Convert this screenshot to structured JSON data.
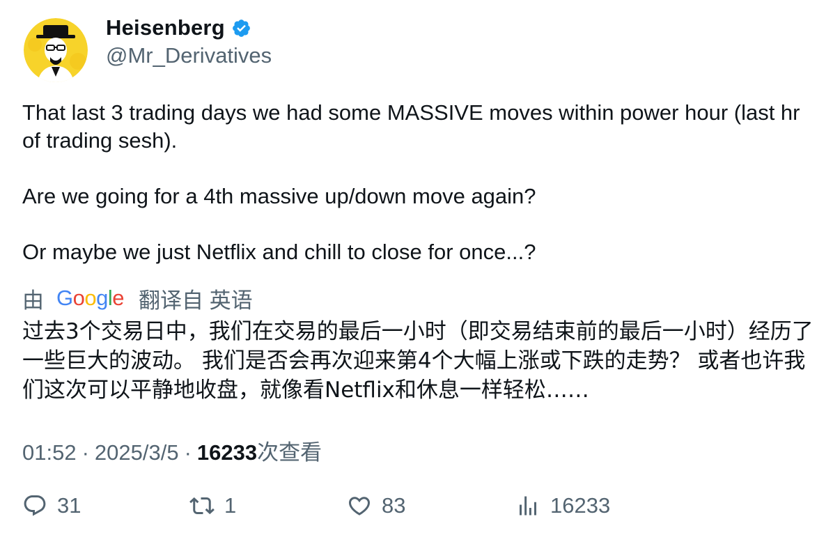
{
  "author": {
    "display_name": "Heisenberg",
    "handle": "@Mr_Derivatives",
    "verified": true,
    "avatar_icon": "heisenberg-avatar-icon"
  },
  "tweet": {
    "paragraphs": [
      "That last 3 trading days we had some MASSIVE moves within power hour (last hr of trading sesh).",
      "Are we going for a 4th massive up/down move again?",
      "Or maybe we just Netflix and chill to close for once...?"
    ]
  },
  "translation": {
    "by_label": "由",
    "provider_logo": "Google",
    "translated_from_label": "翻译自",
    "language_label": "英语",
    "text": "过去3个交易日中，我们在交易的最后一小时（即交易结束前的最后一小时）经历了一些巨大的波动。 我们是否会再次迎来第4个大幅上涨或下跌的走势？ 或者也许我们这次可以平静地收盘，就像看Netflix和休息一样轻松……"
  },
  "meta": {
    "time": "01:52",
    "separator": "·",
    "date": "2025/3/5",
    "views_count": "16233",
    "views_label": "次查看"
  },
  "actions": {
    "replies": "31",
    "reposts": "1",
    "likes": "83",
    "views": "16233"
  },
  "colors": {
    "text_primary": "#0f1419",
    "text_secondary": "#536471",
    "verified_blue": "#1d9bf0",
    "avatar_yellow": "#f7d32a"
  }
}
